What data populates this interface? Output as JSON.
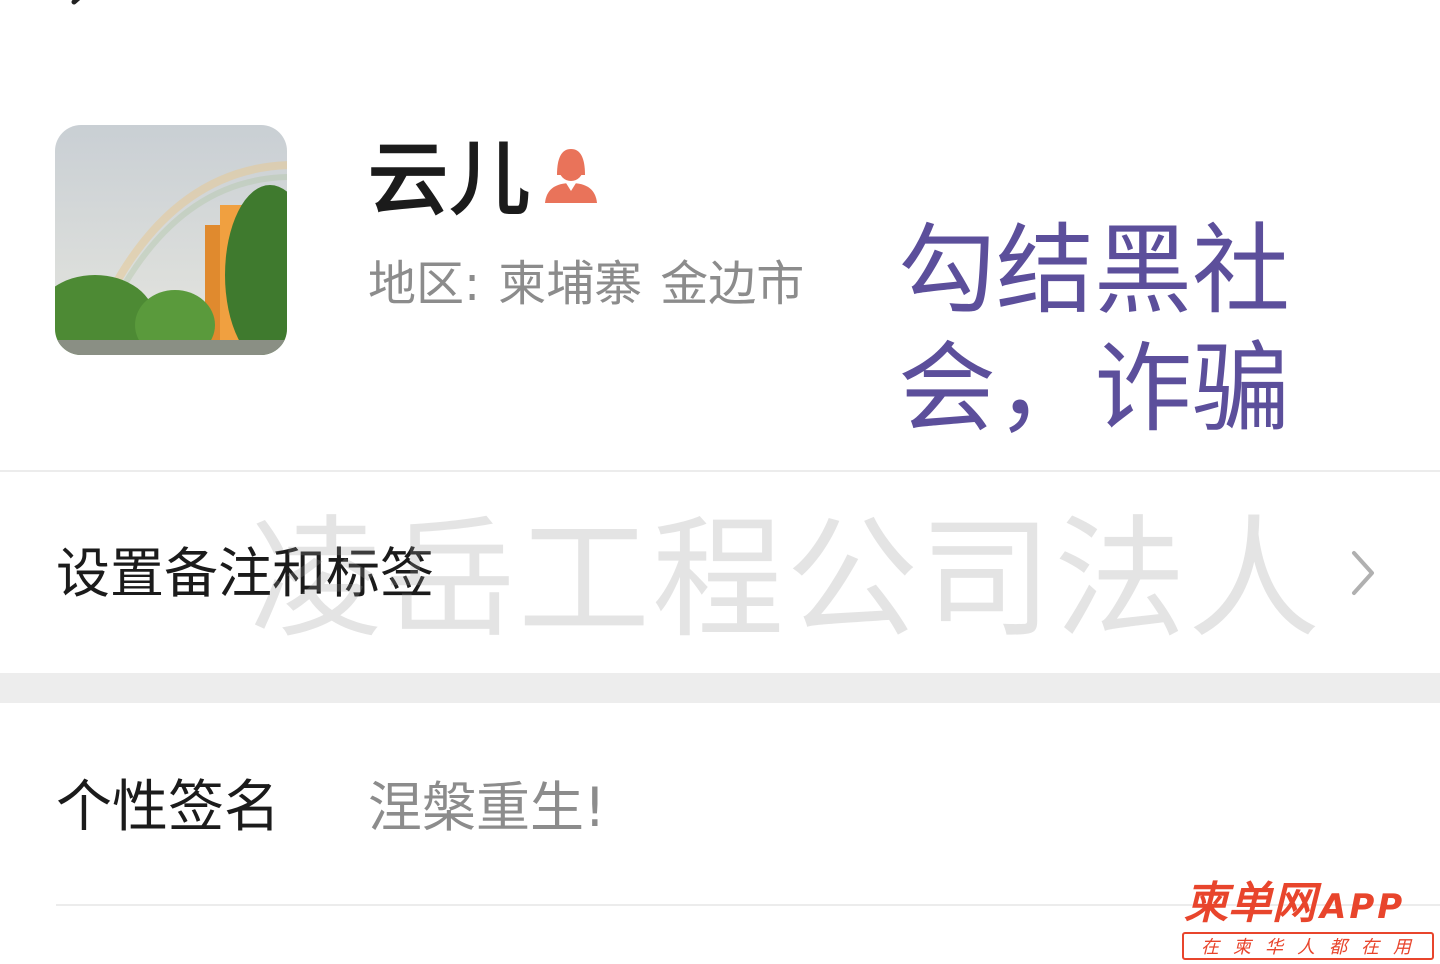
{
  "profile": {
    "name": "云儿",
    "gender_icon": "female-icon",
    "region_label": "地区:",
    "region_country": "柬埔寨",
    "region_city": "金边市"
  },
  "annotation": {
    "text": "勾结黑社会，诈骗"
  },
  "rows": {
    "remark_label": "设置备注和标签",
    "signature_label": "个性签名",
    "signature_value": "涅槃重生!"
  },
  "watermark": {
    "text": "凌岳工程公司法人"
  },
  "logo": {
    "main": "柬单网",
    "app": "APP",
    "tagline": "在柬华人都在用"
  },
  "colors": {
    "annotation": "#5c4f9b",
    "gender_icon": "#e9735a",
    "logo": "#e8452c"
  }
}
